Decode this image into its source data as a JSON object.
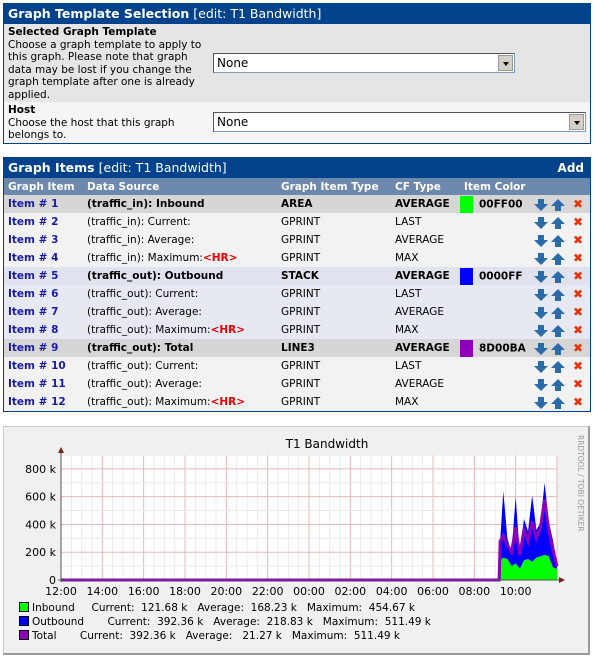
{
  "template_panel": {
    "title": "Graph Template Selection",
    "edit": "[edit: T1 Bandwidth]",
    "fields": [
      {
        "label": "Selected Graph Template",
        "description": "Choose a graph template to apply to this graph. Please note that graph data may be lost if you change the graph template after one is already applied.",
        "value": "None"
      },
      {
        "label": "Host",
        "description": "Choose the host that this graph belongs to.",
        "value": "None"
      }
    ]
  },
  "items_panel": {
    "title": "Graph Items",
    "edit": "[edit: T1 Bandwidth]",
    "add_label": "Add",
    "columns": [
      "Graph Item",
      "Data Source",
      "Graph Item Type",
      "CF Type",
      "Item Color"
    ],
    "rows": [
      {
        "item": "Item # 1",
        "source": "(traffic_in): Inbound",
        "hr": "",
        "type": "AREA",
        "cf": "AVERAGE",
        "color": "00FF00",
        "hex": "#00FF00",
        "main": true
      },
      {
        "item": "Item # 2",
        "source": "(traffic_in): Current:",
        "hr": "",
        "type": "GPRINT",
        "cf": "LAST",
        "color": "",
        "hex": "",
        "main": false
      },
      {
        "item": "Item # 3",
        "source": "(traffic_in): Average:",
        "hr": "",
        "type": "GPRINT",
        "cf": "AVERAGE",
        "color": "",
        "hex": "",
        "main": false
      },
      {
        "item": "Item # 4",
        "source": "(traffic_in): Maximum:",
        "hr": "<HR>",
        "type": "GPRINT",
        "cf": "MAX",
        "color": "",
        "hex": "",
        "main": false
      },
      {
        "item": "Item # 5",
        "source": "(traffic_out): Outbound",
        "hr": "",
        "type": "STACK",
        "cf": "AVERAGE",
        "color": "0000FF",
        "hex": "#0000FF",
        "main": true
      },
      {
        "item": "Item # 6",
        "source": "(traffic_out): Current:",
        "hr": "",
        "type": "GPRINT",
        "cf": "LAST",
        "color": "",
        "hex": "",
        "main": false
      },
      {
        "item": "Item # 7",
        "source": "(traffic_out): Average:",
        "hr": "",
        "type": "GPRINT",
        "cf": "AVERAGE",
        "color": "",
        "hex": "",
        "main": false
      },
      {
        "item": "Item # 8",
        "source": "(traffic_out): Maximum:",
        "hr": "<HR>",
        "type": "GPRINT",
        "cf": "MAX",
        "color": "",
        "hex": "",
        "main": false
      },
      {
        "item": "Item # 9",
        "source": "(traffic_out): Total",
        "hr": "",
        "type": "LINE3",
        "cf": "AVERAGE",
        "color": "8D00BA",
        "hex": "#8D00BA",
        "main": true
      },
      {
        "item": "Item # 10",
        "source": "(traffic_out): Current:",
        "hr": "",
        "type": "GPRINT",
        "cf": "LAST",
        "color": "",
        "hex": "",
        "main": false
      },
      {
        "item": "Item # 11",
        "source": "(traffic_out): Average:",
        "hr": "",
        "type": "GPRINT",
        "cf": "AVERAGE",
        "color": "",
        "hex": "",
        "main": false
      },
      {
        "item": "Item # 12",
        "source": "(traffic_out): Maximum:",
        "hr": "<HR>",
        "type": "GPRINT",
        "cf": "MAX",
        "color": "",
        "hex": "",
        "main": false
      }
    ],
    "actions": {
      "down": "move-down-icon",
      "up": "move-up-icon",
      "delete": "delete-icon"
    }
  },
  "chart_data": {
    "type": "area",
    "title": "T1 Bandwidth",
    "watermark": "RRDTOOL / TOBI OETIKER",
    "ylabel": "",
    "xlabel": "",
    "ylim": [
      0,
      900000
    ],
    "yticks": [
      {
        "v": 0,
        "label": "0"
      },
      {
        "v": 200000,
        "label": "200 k"
      },
      {
        "v": 400000,
        "label": "400 k"
      },
      {
        "v": 600000,
        "label": "600 k"
      },
      {
        "v": 800000,
        "label": "800 k"
      }
    ],
    "xlim": [
      0,
      24
    ],
    "xticks": [
      "12:00",
      "14:00",
      "16:00",
      "18:00",
      "20:00",
      "22:00",
      "00:00",
      "02:00",
      "04:00",
      "06:00",
      "08:00",
      "10:00"
    ],
    "grid": true,
    "x": [
      0,
      21.2,
      21.25,
      21.4,
      21.6,
      21.8,
      22.0,
      22.2,
      22.4,
      22.6,
      22.8,
      23.0,
      23.2,
      23.4,
      23.6,
      23.8,
      24.0
    ],
    "series": [
      {
        "name": "Inbound",
        "color": "#00FF00",
        "style": "area",
        "values": [
          0,
          0,
          140000,
          160000,
          150000,
          100000,
          120000,
          80000,
          140000,
          150000,
          130000,
          160000,
          170000,
          180000,
          170000,
          90000,
          80000
        ]
      },
      {
        "name": "Outbound",
        "color": "#0000FF",
        "style": "stack",
        "values": [
          0,
          0,
          140000,
          480000,
          150000,
          100000,
          480000,
          100000,
          300000,
          200000,
          480000,
          200000,
          240000,
          520000,
          250000,
          200000,
          40000
        ]
      },
      {
        "name": "Total",
        "color": "#8D00BA",
        "style": "line",
        "values": [
          0,
          0,
          280000,
          320000,
          250000,
          200000,
          380000,
          180000,
          360000,
          280000,
          420000,
          300000,
          380000,
          580000,
          360000,
          220000,
          100000
        ]
      }
    ],
    "legend": [
      {
        "name": "Inbound",
        "color": "#00FF00",
        "text": "Inbound     Current:  121.68 k   Average:  168.23 k   Maximum:  454.67 k"
      },
      {
        "name": "Outbound",
        "color": "#0000FF",
        "text": "Outbound       Current:  392.36 k   Average:  218.83 k   Maximum:  511.49 k"
      },
      {
        "name": "Total",
        "color": "#8D00BA",
        "text": "Total       Current:  392.36 k   Average:   21.27 k   Maximum:  511.49 k"
      }
    ]
  }
}
